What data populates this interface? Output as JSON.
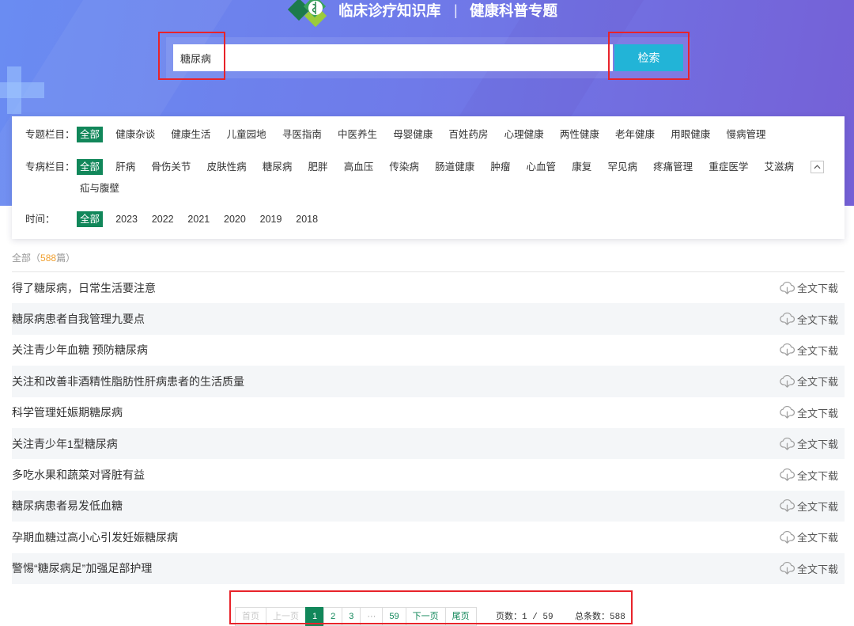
{
  "header": {
    "logo_icon": "medical-logo-icon",
    "title": "临床诊疗知识库",
    "divider": "|",
    "subtitle": "健康科普专题"
  },
  "search": {
    "value": "糖尿病",
    "button_label": "检索"
  },
  "filters": {
    "topic": {
      "label": "专题栏目：",
      "selected": "全部",
      "options": [
        "健康杂谈",
        "健康生活",
        "儿童园地",
        "寻医指南",
        "中医养生",
        "母婴健康",
        "百姓药房",
        "心理健康",
        "两性健康",
        "老年健康",
        "用眼健康",
        "慢病管理"
      ]
    },
    "disease": {
      "label": "专病栏目：",
      "selected": "全部",
      "options": [
        "肝病",
        "骨伤关节",
        "皮肤性病",
        "糖尿病",
        "肥胖",
        "高血压",
        "传染病",
        "肠道健康",
        "肿瘤",
        "心血管",
        "康复",
        "罕见病",
        "疼痛管理",
        "重症医学",
        "艾滋病",
        "疝与腹壁"
      ],
      "collapse_icon": "chevron-up-icon"
    },
    "time": {
      "label": "时间：",
      "selected": "全部",
      "options": [
        "2023",
        "2022",
        "2021",
        "2020",
        "2019",
        "2018"
      ]
    }
  },
  "results": {
    "scope": "全部",
    "count_open": "（",
    "count": "588",
    "count_close": "篇）",
    "download_label": "全文下载",
    "download_icon": "cloud-download-icon",
    "items": [
      "得了糖尿病，日常生活要注意",
      "糖尿病患者自我管理九要点",
      "关注青少年血糖 预防糖尿病",
      "关注和改善非酒精性脂肪性肝病患者的生活质量",
      "科学管理妊娠期糖尿病",
      "关注青少年1型糖尿病",
      "多吃水果和蔬菜对肾脏有益",
      "糖尿病患者易发低血糖",
      "孕期血糖过高小心引发妊娠糖尿病",
      "警惕“糖尿病足”加强足部护理"
    ]
  },
  "pagination": {
    "first": "首页",
    "prev": "上一页",
    "current": "1",
    "pages": [
      "2",
      "3"
    ],
    "ellipsis": "···",
    "last_page": "59",
    "next": "下一页",
    "last": "尾页",
    "page_info_label": "页数：",
    "page_info": "1 / 59",
    "total_label": "总条数：",
    "total": "588"
  },
  "colors": {
    "banner_start": "#6a8cf2",
    "banner_end": "#7560d6",
    "accent_green": "#11875a",
    "search_button": "#22b4d7",
    "count_orange": "#f0a030",
    "annotation_red": "#e8232a",
    "row_alt": "#f4f6f8"
  }
}
